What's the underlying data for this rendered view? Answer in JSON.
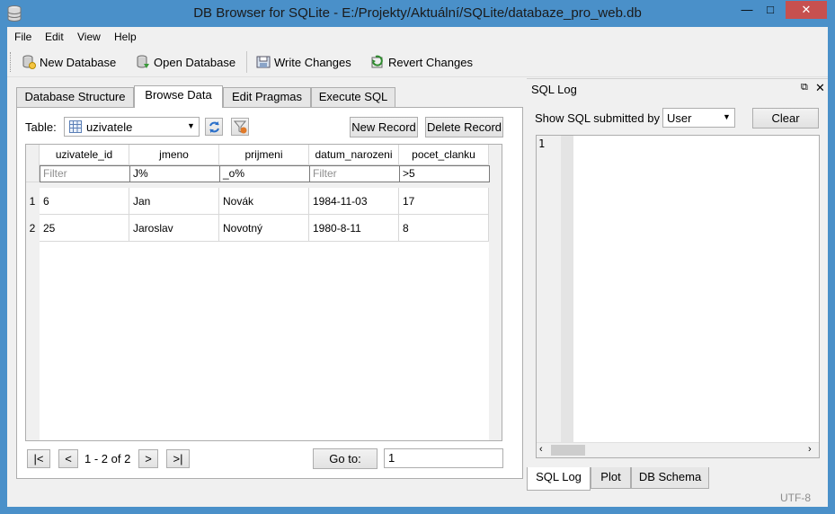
{
  "window": {
    "title": "DB Browser for SQLite - E:/Projekty/Aktuální/SQLite/databaze_pro_web.db"
  },
  "menu": [
    "File",
    "Edit",
    "View",
    "Help"
  ],
  "toolbar": {
    "new_database": "New Database",
    "open_database": "Open Database",
    "write_changes": "Write Changes",
    "revert_changes": "Revert Changes"
  },
  "tabs": [
    "Database Structure",
    "Browse Data",
    "Edit Pragmas",
    "Execute SQL"
  ],
  "browse": {
    "table_label": "Table:",
    "table_selected": "uzivatele",
    "new_record": "New Record",
    "delete_record": "Delete Record",
    "columns": [
      "uzivatele_id",
      "jmeno",
      "prijmeni",
      "datum_narozeni",
      "pocet_clanku"
    ],
    "filters": [
      "",
      "J%",
      "_o%",
      "",
      ">5"
    ],
    "filter_placeholder": "Filter",
    "rows": [
      {
        "num": "1",
        "cells": [
          "6",
          "Jan",
          "Novák",
          "1984-11-03",
          "17"
        ]
      },
      {
        "num": "2",
        "cells": [
          "25",
          "Jaroslav",
          "Novotný",
          "1980-8-11",
          "8"
        ]
      }
    ],
    "nav_first": "|<",
    "nav_prev": "<",
    "nav_status": "1 - 2 of 2",
    "nav_next": ">",
    "nav_last": ">|",
    "goto_label": "Go to:",
    "goto_value": "1"
  },
  "sqllog": {
    "title": "SQL Log",
    "show_label": "Show SQL submitted by",
    "submitted_by": "User",
    "clear": "Clear",
    "line_number": "1",
    "tabs": [
      "SQL Log",
      "Plot",
      "DB Schema"
    ]
  },
  "statusbar": {
    "encoding": "UTF-8"
  },
  "colors": {
    "titlebar": "#4a90c9",
    "close": "#c7504f",
    "window_bg": "#f0f0f0"
  }
}
